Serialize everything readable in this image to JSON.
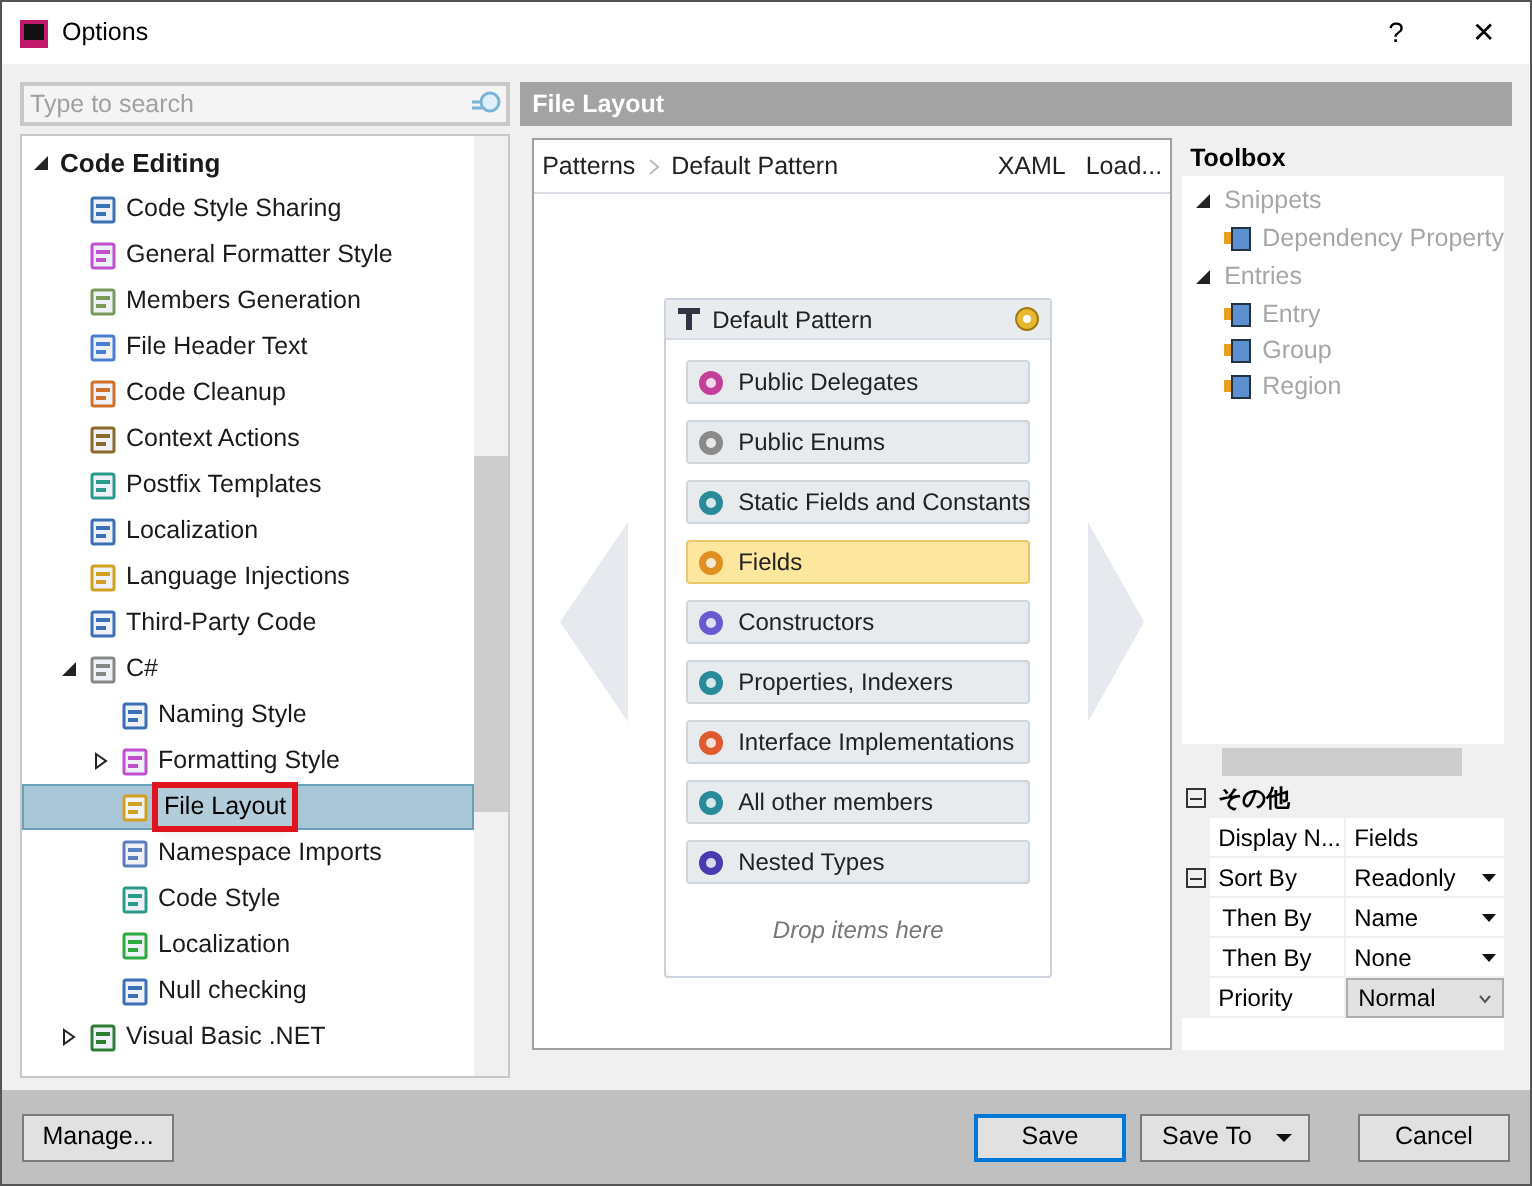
{
  "window": {
    "title": "Options",
    "help": "?",
    "close": "✕"
  },
  "search": {
    "placeholder": "Type to search"
  },
  "tree": [
    {
      "label": "Code Editing",
      "expanded": true,
      "selected": false,
      "children": [
        {
          "label": "Code Style Sharing",
          "selected": false
        },
        {
          "label": "General Formatter Style",
          "selected": false
        },
        {
          "label": "Members Generation",
          "selected": false
        },
        {
          "label": "File Header Text",
          "selected": false
        },
        {
          "label": "Code Cleanup",
          "selected": false
        },
        {
          "label": "Context Actions",
          "selected": false
        },
        {
          "label": "Postfix Templates",
          "selected": false
        },
        {
          "label": "Localization",
          "selected": false
        },
        {
          "label": "Language Injections",
          "selected": false
        },
        {
          "label": "Third-Party Code",
          "selected": false
        },
        {
          "label": "C#",
          "expanded": true,
          "selected": false,
          "children": [
            {
              "label": "Naming Style",
              "selected": false
            },
            {
              "label": "Formatting Style",
              "expanded": false,
              "selected": false
            },
            {
              "label": "File Layout",
              "selected": true
            },
            {
              "label": "Namespace Imports",
              "selected": false
            },
            {
              "label": "Code Style",
              "selected": false
            },
            {
              "label": "Localization",
              "selected": false
            },
            {
              "label": "Null checking",
              "selected": false
            }
          ]
        },
        {
          "label": "Visual Basic .NET",
          "expanded": false,
          "selected": false
        }
      ]
    }
  ],
  "page": {
    "title": "File Layout"
  },
  "breadcrumb": [
    "Patterns",
    "Default Pattern"
  ],
  "toolbar_links": [
    "XAML",
    "Load..."
  ],
  "pattern": {
    "title": "Default Pattern",
    "entries": [
      {
        "label": "Public Delegates",
        "selected": false
      },
      {
        "label": "Public Enums",
        "selected": false
      },
      {
        "label": "Static Fields and Constants",
        "selected": false
      },
      {
        "label": "Fields",
        "selected": true
      },
      {
        "label": "Constructors",
        "selected": false
      },
      {
        "label": "Properties, Indexers",
        "selected": false
      },
      {
        "label": "Interface Implementations",
        "selected": false
      },
      {
        "label": "All other members",
        "selected": false
      },
      {
        "label": "Nested Types",
        "selected": false
      }
    ],
    "drop_hint": "Drop items here"
  },
  "toolbox": {
    "title": "Toolbox",
    "groups": [
      {
        "label": "Snippets",
        "expanded": true,
        "disabled": true,
        "items": [
          {
            "label": "Dependency Property",
            "disabled": true
          }
        ]
      },
      {
        "label": "Entries",
        "expanded": true,
        "disabled": true,
        "items": [
          {
            "label": "Entry",
            "disabled": true
          },
          {
            "label": "Group",
            "disabled": true
          },
          {
            "label": "Region",
            "disabled": true
          }
        ]
      }
    ]
  },
  "properties": {
    "category": "その他",
    "expanded": true,
    "rows": [
      {
        "kind": "text",
        "label": "Display N...",
        "value": "Fields",
        "indent": false
      },
      {
        "kind": "dropdown",
        "label": "Sort By",
        "value": "Readonly",
        "collapsible": true,
        "indent": false
      },
      {
        "kind": "dropdown",
        "label": "Then By",
        "value": "Name",
        "indent": true
      },
      {
        "kind": "dropdown",
        "label": "Then By",
        "value": "None",
        "indent": true
      },
      {
        "kind": "combo",
        "label": "Priority",
        "value": "Normal",
        "indent": false
      }
    ]
  },
  "buttons": {
    "manage": "Manage...",
    "save": "Save",
    "save_to": "Save To",
    "cancel": "Cancel"
  }
}
